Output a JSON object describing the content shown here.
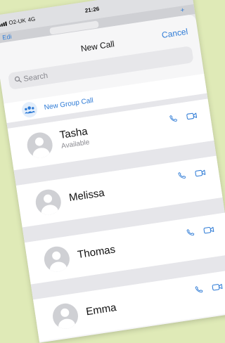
{
  "status_bar": {
    "carrier": "O2-UK",
    "network": "4G",
    "time": "21:26"
  },
  "background_app": {
    "edit_label": "Edi",
    "plus_label": "+"
  },
  "sheet": {
    "title": "New Call",
    "cancel_label": "Cancel"
  },
  "search": {
    "placeholder": "Search"
  },
  "new_group_call": {
    "label": "New Group Call"
  },
  "contacts": [
    {
      "name": "Tasha",
      "status": "Available"
    },
    {
      "name": "Melissa"
    },
    {
      "name": "Thomas"
    },
    {
      "name": "Emma"
    }
  ],
  "colors": {
    "accent": "#2e7bd6",
    "background": "#dfeab7"
  }
}
